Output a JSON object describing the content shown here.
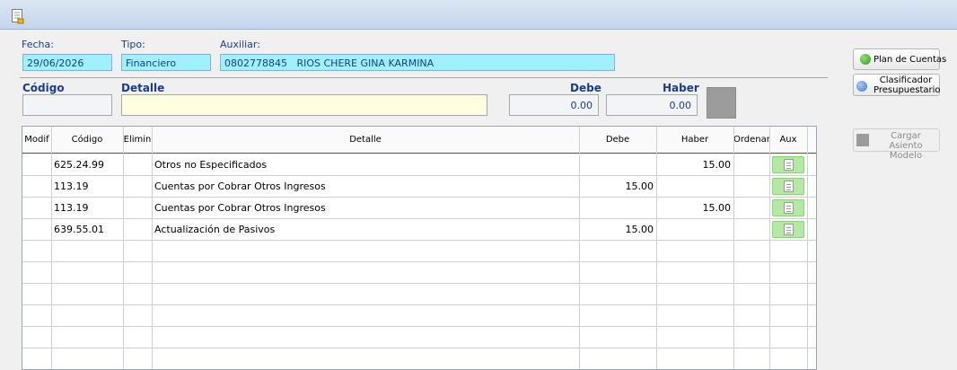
{
  "header": {
    "fecha": {
      "label": "Fecha:",
      "value": "29/06/2026"
    },
    "tipo": {
      "label": "Tipo:",
      "value": "Financiero"
    },
    "auxiliar": {
      "label": "Auxiliar:",
      "value": "0802778845   RIOS CHERE GINA KARMINA"
    }
  },
  "entry": {
    "codigo": {
      "label": "Código",
      "value": ""
    },
    "detalle": {
      "label": "Detalle",
      "value": ""
    },
    "debe": {
      "label": "Debe",
      "value": "0.00"
    },
    "haber": {
      "label": "Haber",
      "value": "0.00"
    }
  },
  "side_buttons": {
    "plan": "Plan de Cuentas",
    "clasificador_1": "Clasificador",
    "clasificador_2": "Presupuestario",
    "cargar_1": "Cargar Asiento",
    "cargar_2": "Modelo"
  },
  "colors": {
    "plan_icon": "#3fae2a",
    "clasificador_icon": "#4a8fd4",
    "accent_text": "#1a3c8c"
  },
  "grid": {
    "columns": {
      "modif": "Modif",
      "codigo": "Código",
      "elimin": "Elimin",
      "detalle": "Detalle",
      "debe": "Debe",
      "haber": "Haber",
      "ordenar": "Ordenar",
      "aux": "Aux"
    },
    "rows": [
      {
        "codigo": "625.24.99",
        "detalle": "Otros no Especificados",
        "debe": "",
        "haber": "15.00"
      },
      {
        "codigo": "113.19",
        "detalle": "Cuentas por Cobrar Otros Ingresos",
        "debe": "15.00",
        "haber": ""
      },
      {
        "codigo": "113.19",
        "detalle": "Cuentas por Cobrar Otros Ingresos",
        "debe": "",
        "haber": "15.00"
      },
      {
        "codigo": "639.55.01",
        "detalle": "Actualización de Pasivos",
        "debe": "15.00",
        "haber": ""
      }
    ]
  }
}
